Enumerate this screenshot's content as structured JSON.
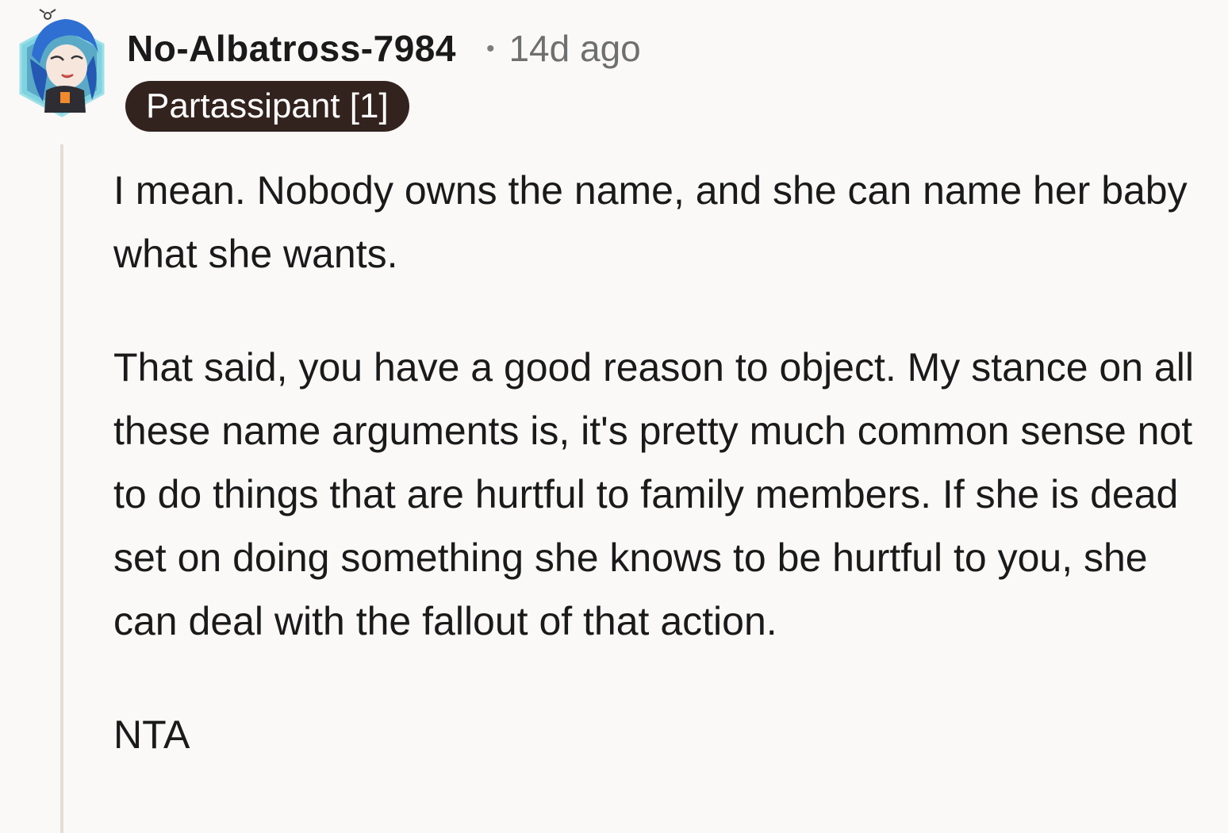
{
  "comment": {
    "author": "No-Albatross-7984",
    "separator": "•",
    "timestamp": "14d ago",
    "flair": "Partassipant [1]",
    "avatar_icon": "user-avatar-icon",
    "paragraphs": [
      "I mean. Nobody owns the name, and she can name her baby what she wants.",
      "That said, you have a good reason to object. My stance on all these name arguments is, it's pretty much common sense not to do things that are hurtful to family members. If she is dead set on doing something she knows to be hurtful to you, she can deal with the fallout of that action.",
      "NTA"
    ]
  },
  "colors": {
    "background": "#faf9f7",
    "flair_background": "#33231f",
    "flair_text": "#ffffff",
    "thread_line": "#e5ddd6",
    "timestamp": "#6f6f6f"
  }
}
